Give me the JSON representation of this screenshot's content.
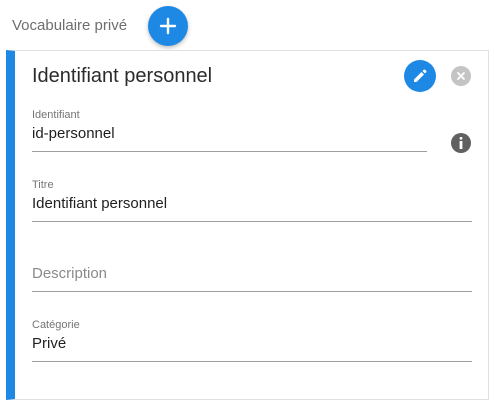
{
  "header": {
    "title": "Vocabulaire privé"
  },
  "card": {
    "title": "Identifiant personnel",
    "accent_color": "#1e88e5"
  },
  "fields": {
    "identifiant": {
      "label": "Identifiant",
      "value": "id-personnel"
    },
    "titre": {
      "label": "Titre",
      "value": "Identifiant personnel"
    },
    "description": {
      "placeholder": "Description"
    },
    "categorie": {
      "label": "Catégorie",
      "value": "Privé"
    }
  },
  "icons": {
    "add": "plus-icon",
    "edit": "pencil-icon",
    "close": "close-icon",
    "info": "info-icon"
  }
}
